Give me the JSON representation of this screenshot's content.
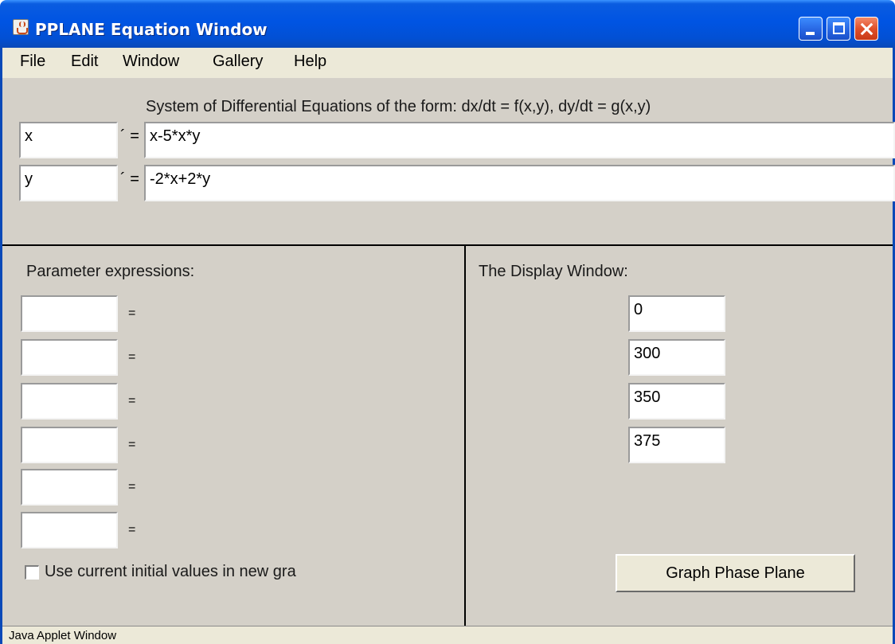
{
  "window": {
    "title": "PPLANE Equation Window",
    "title_color": "#0054e3",
    "background": "#d4d0c8"
  },
  "menu": [
    "File",
    "Edit",
    "Window",
    "Gallery",
    "Help"
  ],
  "equations": {
    "header": "System of Differential Equations of the form: dx/dt = f(x,y), dy/dt = g(x,y)",
    "prime_symbol": "´ =",
    "rows": [
      {
        "variable": "x",
        "expression": "x-5*x*y"
      },
      {
        "variable": "y",
        "expression": "-2*x+2*y"
      }
    ]
  },
  "parameters": {
    "title": "Parameter expressions:",
    "equals_symbol": "=",
    "rows": [
      {
        "name": ""
      },
      {
        "name": ""
      },
      {
        "name": ""
      },
      {
        "name": ""
      },
      {
        "name": ""
      },
      {
        "name": ""
      }
    ]
  },
  "display_window": {
    "title": "The Display Window:",
    "values": [
      "0",
      "300",
      "350",
      "375"
    ]
  },
  "checkbox": {
    "label": "Use current initial values in new gra",
    "checked": false
  },
  "graph_button": {
    "label": "Graph Phase Plane"
  },
  "status": {
    "text": "Java Applet Window"
  },
  "icons": [
    "java-icon",
    "minimize-icon",
    "maximize-icon",
    "close-icon"
  ]
}
